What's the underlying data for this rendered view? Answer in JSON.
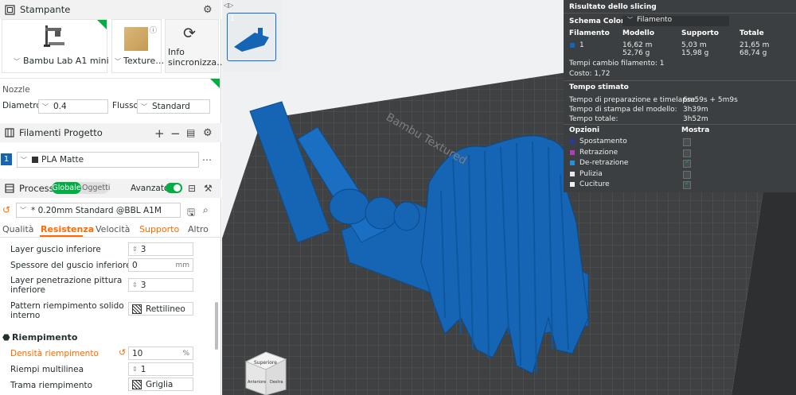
{
  "printer": {
    "title": "Stampante",
    "model": "Bambu Lab A1 mini",
    "plate": "Texture…",
    "sync_label_1": "Info",
    "sync_label_2": "sincronizza…"
  },
  "nozzle": {
    "title": "Nozzle",
    "diameter_label": "Diametro",
    "diameter_value": "0.4",
    "flow_label": "Flusso",
    "flow_value": "Standard"
  },
  "filaments": {
    "title": "Filamenti Progetto",
    "index": "1",
    "name": "PLA Matte",
    "color": "#1565b4"
  },
  "process": {
    "title": "Processo",
    "mode_global": "Globale",
    "mode_objects": "Oggetti",
    "advanced_label": "Avanzato",
    "preset": "* 0.20mm Standard @BBL A1M",
    "tabs": [
      "Qualità",
      "Resistenza",
      "Velocità",
      "Supporto",
      "Altro"
    ],
    "active_tab": "Resistenza"
  },
  "settings": {
    "bottom_layers_label": "Layer guscio inferiore",
    "bottom_layers_value": "3",
    "bottom_thickness_label": "Spessore del guscio inferiore",
    "bottom_thickness_value": "0",
    "bottom_thickness_unit": "mm",
    "paint_penetration_label_1": "Layer penetrazione pittura",
    "paint_penetration_label_2": "inferiore",
    "paint_penetration_value": "3",
    "solid_pattern_label_1": "Pattern riempimento solido",
    "solid_pattern_label_2": "interno",
    "solid_pattern_value": "Rettilineo",
    "infill_section": "Riempimento",
    "density_label": "Densità riempimento",
    "density_value": "10",
    "density_unit": "%",
    "multiline_label": "Riempi multilinea",
    "multiline_value": "1",
    "pattern_label": "Trama riempimento",
    "pattern_value": "Griglia"
  },
  "viewport": {
    "thumb_index": "1",
    "bed_label": "Bambu Textured",
    "cube_top": "Superiore",
    "cube_front": "Anteriore",
    "cube_right": "Destra"
  },
  "results": {
    "title": "Risultato dello slicing",
    "scheme_label": "Schema Colore",
    "scheme_value": "Filamento",
    "col_filament": "Filamento",
    "col_model": "Modello",
    "col_support": "Supporto",
    "col_total": "Totale",
    "row_index": "1",
    "model_m": "16,62 m",
    "model_g": "52,76 g",
    "support_m": "5,03 m",
    "support_g": "15,98 g",
    "total_m": "21,65 m",
    "total_g": "68,74 g",
    "change_time": "Tempi cambio filamento:  1",
    "cost": "Costo:  1,72",
    "time_title": "Tempo stimato",
    "prep_label": "Tempo di preparazione e timelapse:",
    "prep_value": "6m59s + 5m9s",
    "print_label": "Tempo di stampa del modello:",
    "print_value": "3h39m",
    "total_time_label": "Tempo totale:",
    "total_time_value": "3h52m",
    "options_title": "Opzioni",
    "show_title": "Mostra",
    "options": [
      {
        "label": "Spostamento",
        "color": "#2a3a9a",
        "checked": false
      },
      {
        "label": "Retrazione",
        "color": "#b43ab8",
        "checked": false
      },
      {
        "label": "De-retrazione",
        "color": "#2a8fd8",
        "checked": true
      },
      {
        "label": "Pulizia",
        "color": "#e8e8e8",
        "checked": false
      },
      {
        "label": "Cuciture",
        "color": "#f0f0f0",
        "checked": true
      }
    ]
  },
  "colors": {
    "accent": "#00ae42",
    "model_blue": "#1565b4",
    "orange": "#ff6b00"
  }
}
